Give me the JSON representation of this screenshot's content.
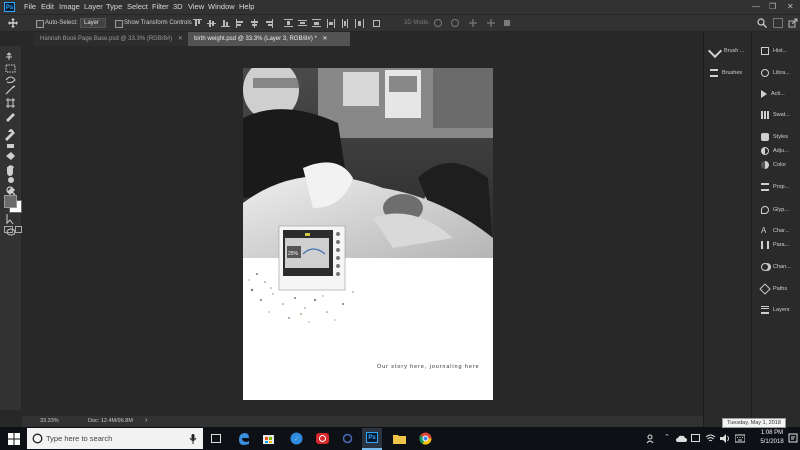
{
  "app": {
    "logo": "Ps"
  },
  "menubar": {
    "items": [
      "File",
      "Edit",
      "Image",
      "Layer",
      "Type",
      "Select",
      "Filter",
      "3D",
      "View",
      "Window",
      "Help"
    ]
  },
  "window_controls": {
    "minimize": "—",
    "restore": "❐",
    "close": "✕"
  },
  "optionsbar": {
    "auto_select_label": "Auto-Select:",
    "auto_select_value": "Layer",
    "transform_label": "Show Transform Controls",
    "mode_3d": "3D Mode:"
  },
  "tabs": [
    {
      "label": "Hannah Book Page Base.psd @ 33.3% (RGB/8#)",
      "close": "✕"
    },
    {
      "label": "birth weight.psd @ 33.3% (Layer 3, RGB/8#) *",
      "close": "✕"
    }
  ],
  "document": {
    "journal_text": "Our story here, journaling here"
  },
  "statusbar": {
    "zoom": "33.33%",
    "doc_info": "Doc: 12.4M/96.8M",
    "arrow": "›"
  },
  "panels_left": [
    {
      "label": "Brush ...",
      "icon": "brush-settings-icon"
    },
    {
      "label": "Brushes",
      "icon": "brushes-icon"
    }
  ],
  "panels_right": [
    {
      "label": "Hist...",
      "icon": "history-icon"
    },
    {
      "label": "Libra...",
      "icon": "libraries-icon"
    },
    {
      "label": "Acti...",
      "icon": "actions-icon"
    },
    {
      "label": "Swat...",
      "icon": "swatches-icon"
    },
    {
      "label": "Styles",
      "icon": "styles-icon"
    },
    {
      "label": "Adju...",
      "icon": "adjustments-icon"
    },
    {
      "label": "Color",
      "icon": "color-icon"
    },
    {
      "label": "Prop...",
      "icon": "properties-icon"
    },
    {
      "label": "Glyp...",
      "icon": "glyphs-icon"
    },
    {
      "label": "Char...",
      "icon": "character-icon"
    },
    {
      "label": "Para...",
      "icon": "paragraph-icon"
    },
    {
      "label": "Chan...",
      "icon": "channels-icon"
    },
    {
      "label": "Paths",
      "icon": "paths-icon"
    },
    {
      "label": "Layers",
      "icon": "layers-icon"
    }
  ],
  "taskbar": {
    "search_placeholder": "Type here to search",
    "time": "1:08 PM",
    "date": "5/1/2018",
    "tooltip": "Tuesday, May 1, 2018"
  },
  "colors": {
    "accent": "#31a8ff",
    "ui_dark": "#323232",
    "canvas_bg": "#282828",
    "taskbar": "#0d1116"
  }
}
